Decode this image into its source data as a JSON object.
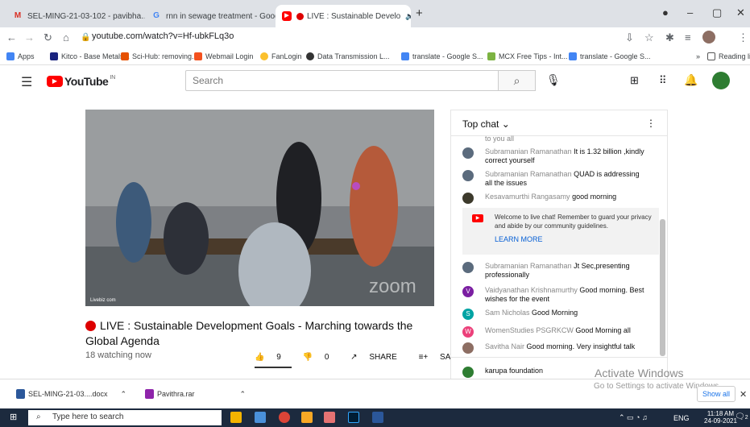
{
  "tabs": [
    {
      "label": "SEL-MING-21-03-102 - pavibha…",
      "icon": "gmail-icon"
    },
    {
      "label": "rnn in sewage treatment - Googl",
      "icon": "google-icon"
    },
    {
      "label": "LIVE : Sustainable Develo",
      "icon": "youtube-icon"
    }
  ],
  "address": {
    "url": "youtube.com/watch?v=Hf-ubkFLq3o"
  },
  "bookmarks": [
    "Apps",
    "Kitco - Base Metals...",
    "Sci-Hub: removing...",
    "Webmail Login",
    "FanLogin",
    "Data Transmission L...",
    "translate - Google S...",
    "MCX Free Tips - Int...",
    "translate - Google S..."
  ],
  "bookmarks_more": "»",
  "reading_list": "Reading list",
  "youtube": {
    "logo": "YouTube",
    "country": "IN",
    "search_placeholder": "Search"
  },
  "video": {
    "title": "LIVE : Sustainable Development Goals - Marching towards the Global Agenda",
    "watching": "18 watching now",
    "likes": "9",
    "dislikes": "0",
    "share": "SHARE",
    "save": "SAVE",
    "watermark": "zoom",
    "corner_label": "Livebiz com"
  },
  "chat": {
    "header": "Top chat",
    "messages": [
      {
        "author": "",
        "text": "to you all",
        "color": "#555555"
      },
      {
        "author": "Subramanian Ramanathan",
        "text": "It is 1.32 billion ,kindly correct yourself",
        "color": "#5b6b7d"
      },
      {
        "author": "Subramanian Ramanathan",
        "text": "QUAD is addressing all the issues",
        "color": "#5b6b7d"
      },
      {
        "author": "Kesavamurthi Rangasamy",
        "text": "good morning",
        "color": "#3d3a2c"
      },
      {
        "author": "Subramanian Ramanathan",
        "text": "Jt Sec,presenting professionally",
        "color": "#5b6b7d"
      },
      {
        "author": "Vaidyanathan Krishnamurthy",
        "text": "Good morning. Best wishes for the event",
        "color": "#7b1fa2",
        "initial": "V"
      },
      {
        "author": "Sam Nicholas",
        "text": "Good Morning",
        "color": "#00a3a3",
        "initial": "S"
      },
      {
        "author": "WomenStudies PSGRKCW",
        "text": "Good Morning all",
        "color": "#ec407a",
        "initial": "W"
      },
      {
        "author": "Savitha Nair",
        "text": "Good morning. Very insightful talk",
        "color": "#8d6e63"
      },
      {
        "author": "karupa foundation",
        "text": "",
        "color": "#2e7d32"
      }
    ],
    "welcome": "Welcome to live chat! Remember to guard your privacy and abide by our community guidelines.",
    "learn_more": "LEARN MORE"
  },
  "activate": {
    "title": "Activate Windows",
    "subtitle": "Go to Settings to activate Windows."
  },
  "downloads": [
    {
      "name": "SEL-MING-21-03....docx"
    },
    {
      "name": "Pavithra.rar"
    }
  ],
  "show_all": "Show all",
  "taskbar": {
    "search": "Type here to search",
    "time": "11:18 AM",
    "date": "24-09-2021",
    "lang": "ENG",
    "notif": "2"
  }
}
